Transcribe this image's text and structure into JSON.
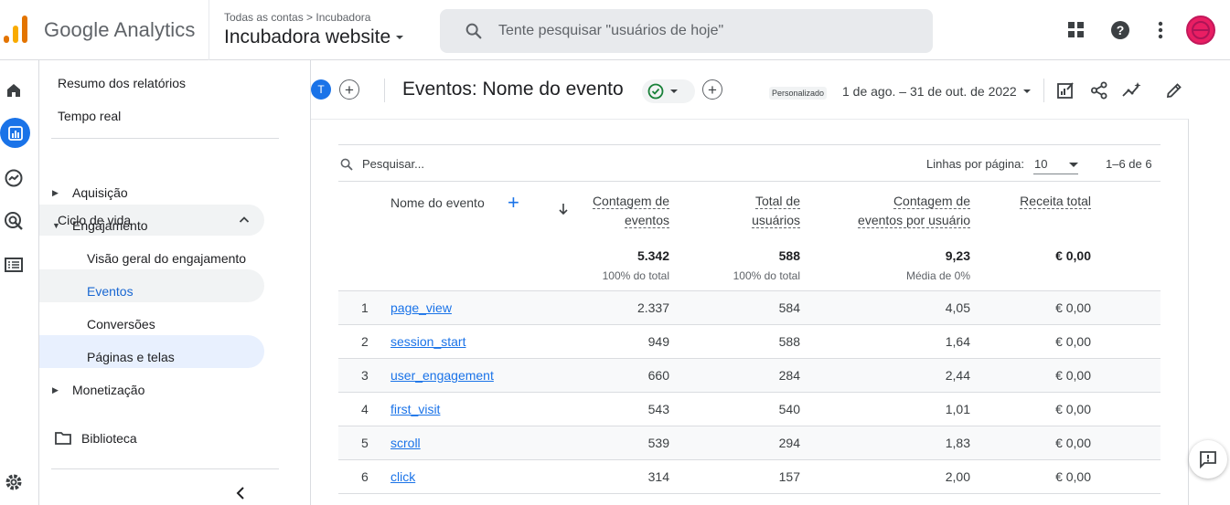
{
  "app": {
    "product_name": "Google Analytics",
    "breadcrumb": "Todas as contas > Incubadora",
    "property_name": "Incubadora website",
    "search_placeholder": "Tente pesquisar \"usuários de hoje\"",
    "brand_colors": {
      "accent": "#1a73e8",
      "logo_orange": "#f9ab00",
      "logo_dark_orange": "#e37400",
      "avatar": "#e91e63"
    },
    "top_icons": [
      "apps-grid-icon",
      "help-icon",
      "more-vert-icon",
      "avatar"
    ]
  },
  "rail": {
    "icons": [
      "home-icon",
      "reports-icon",
      "explore-icon",
      "advertising-icon",
      "configure-icon",
      "settings-icon"
    ],
    "active": "reports-icon"
  },
  "nav": {
    "summary": "Resumo dos relatórios",
    "realtime": "Tempo real",
    "lifecycle": "Ciclo de vida",
    "acquisition": "Aquisição",
    "engagement": "Engajamento",
    "engagement_overview": "Visão geral do engajamento",
    "events": "Eventos",
    "conversions": "Conversões",
    "pages_screens": "Páginas e telas",
    "monetization": "Monetização",
    "library": "Biblioteca"
  },
  "header": {
    "comparison_chip": "T",
    "title": "Eventos: Nome do evento",
    "date_badge": "Personalizado",
    "date_range": "1 de ago. – 31 de out. de 2022"
  },
  "table": {
    "search_placeholder": "Pesquisar...",
    "rows_per_page_label": "Linhas por página:",
    "rows_per_page": "10",
    "pagination": "1–6 de 6",
    "columns": {
      "name": "Nome do evento",
      "event_count_1": "Contagem de",
      "event_count_2": "eventos",
      "total_users_1": "Total de",
      "total_users_2": "usuários",
      "per_user_1": "Contagem de",
      "per_user_2": "eventos por usuário",
      "revenue": "Receita total"
    },
    "totals": {
      "event_count": "5.342",
      "event_count_sub": "100% do total",
      "total_users": "588",
      "total_users_sub": "100% do total",
      "per_user": "9,23",
      "per_user_sub": "Média de 0%",
      "revenue": "€ 0,00"
    },
    "rows": [
      {
        "idx": "1",
        "name": "page_view",
        "count": "2.337",
        "users": "584",
        "per_user": "4,05",
        "revenue": "€ 0,00"
      },
      {
        "idx": "2",
        "name": "session_start",
        "count": "949",
        "users": "588",
        "per_user": "1,64",
        "revenue": "€ 0,00"
      },
      {
        "idx": "3",
        "name": "user_engagement",
        "count": "660",
        "users": "284",
        "per_user": "2,44",
        "revenue": "€ 0,00"
      },
      {
        "idx": "4",
        "name": "first_visit",
        "count": "543",
        "users": "540",
        "per_user": "1,01",
        "revenue": "€ 0,00"
      },
      {
        "idx": "5",
        "name": "scroll",
        "count": "539",
        "users": "294",
        "per_user": "1,83",
        "revenue": "€ 0,00"
      },
      {
        "idx": "6",
        "name": "click",
        "count": "314",
        "users": "157",
        "per_user": "2,00",
        "revenue": "€ 0,00"
      }
    ]
  }
}
